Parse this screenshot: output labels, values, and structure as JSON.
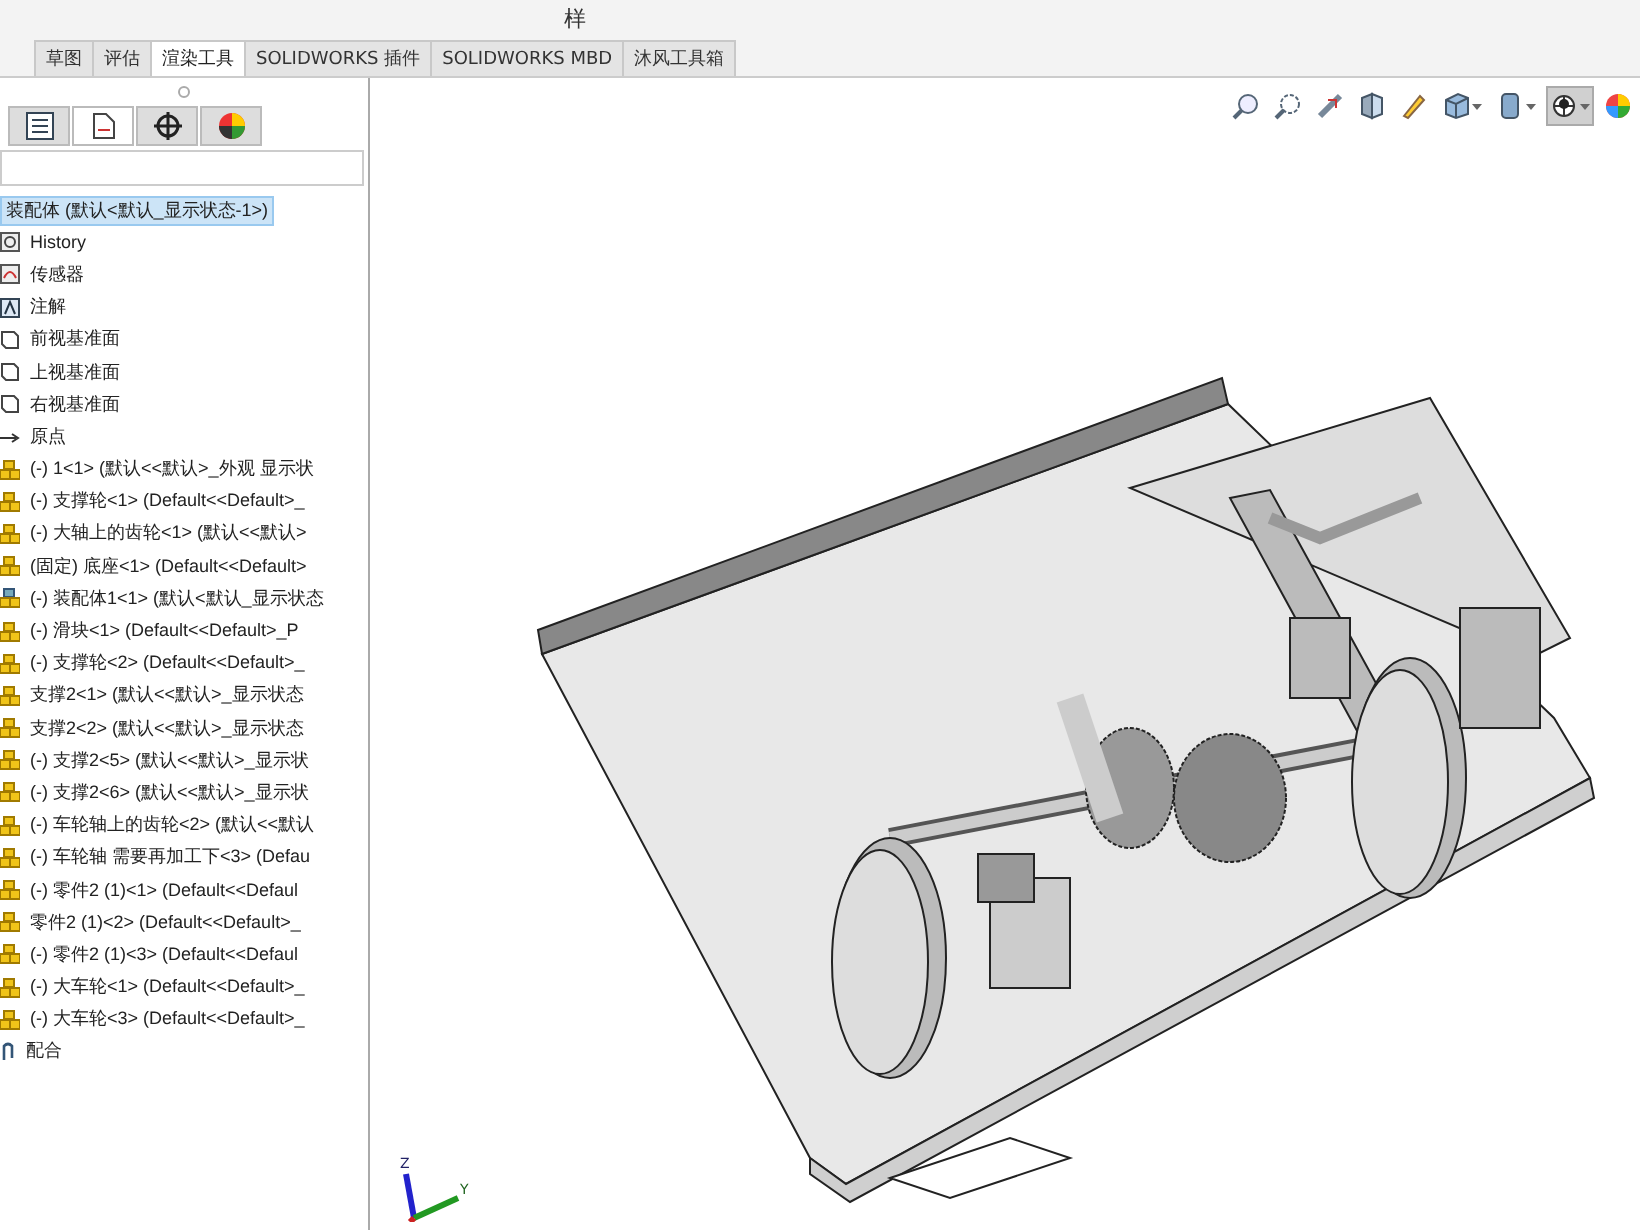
{
  "ribbon_labels": [
    "样"
  ],
  "tabs": [
    {
      "label": "草图",
      "selected": false
    },
    {
      "label": "评估",
      "selected": false
    },
    {
      "label": "渲染工具",
      "selected": true
    },
    {
      "label": "SOLIDWORKS 插件",
      "selected": false
    },
    {
      "label": "SOLIDWORKS MBD",
      "selected": false
    },
    {
      "label": "沐风工具箱",
      "selected": false
    }
  ],
  "panel_tabs": [
    {
      "kind": "tree",
      "selected": false
    },
    {
      "kind": "property",
      "selected": true
    },
    {
      "kind": "config",
      "selected": false
    },
    {
      "kind": "display",
      "selected": false
    }
  ],
  "view_tools": [
    {
      "kind": "zoom",
      "pressed": false
    },
    {
      "kind": "zoom-area",
      "pressed": false
    },
    {
      "kind": "previous",
      "pressed": false
    },
    {
      "kind": "section",
      "pressed": false
    },
    {
      "kind": "dynamic",
      "pressed": false
    },
    {
      "kind": "orientation",
      "pressed": false
    },
    {
      "kind": "display-style",
      "pressed": false
    },
    {
      "kind": "hide-show",
      "pressed": true
    },
    {
      "kind": "appearance",
      "pressed": false
    }
  ],
  "tree": {
    "root": {
      "label": "装配体  (默认<默认_显示状态-1>)",
      "selected": true
    },
    "items": [
      {
        "kind": "history",
        "label": "History"
      },
      {
        "kind": "sensor",
        "label": "传感器"
      },
      {
        "kind": "annotation",
        "label": "注解"
      },
      {
        "kind": "plane",
        "label": "前视基准面"
      },
      {
        "kind": "plane",
        "label": "上视基准面"
      },
      {
        "kind": "plane",
        "label": "右视基准面"
      },
      {
        "kind": "origin",
        "label": "原点"
      },
      {
        "kind": "part",
        "label": "(-) 1<1> (默认<<默认>_外观 显示状"
      },
      {
        "kind": "part",
        "label": "(-) 支撑轮<1> (Default<<Default>_"
      },
      {
        "kind": "part",
        "label": "(-) 大轴上的齿轮<1> (默认<<默认>"
      },
      {
        "kind": "part",
        "label": "(固定) 底座<1> (Default<<Default>"
      },
      {
        "kind": "assembly",
        "label": "(-) 装配体1<1> (默认<默认_显示状态"
      },
      {
        "kind": "part",
        "label": "(-) 滑块<1> (Default<<Default>_P"
      },
      {
        "kind": "part",
        "label": "(-) 支撑轮<2> (Default<<Default>_"
      },
      {
        "kind": "part",
        "label": "支撑2<1> (默认<<默认>_显示状态"
      },
      {
        "kind": "part",
        "label": "支撑2<2> (默认<<默认>_显示状态"
      },
      {
        "kind": "part",
        "label": "(-) 支撑2<5> (默认<<默认>_显示状"
      },
      {
        "kind": "part",
        "label": "(-) 支撑2<6> (默认<<默认>_显示状"
      },
      {
        "kind": "part",
        "label": "(-) 车轮轴上的齿轮<2> (默认<<默认"
      },
      {
        "kind": "part",
        "label": "(-) 车轮轴 需要再加工下<3> (Defau"
      },
      {
        "kind": "part",
        "label": "(-) 零件2 (1)<1> (Default<<Defaul"
      },
      {
        "kind": "part",
        "label": "零件2 (1)<2> (Default<<Default>_"
      },
      {
        "kind": "part",
        "label": "(-) 零件2 (1)<3> (Default<<Defaul"
      },
      {
        "kind": "part",
        "label": "(-) 大车轮<1> (Default<<Default>_"
      },
      {
        "kind": "part",
        "label": "(-) 大车轮<3> (Default<<Default>_"
      },
      {
        "kind": "mates",
        "label": "配合"
      }
    ]
  },
  "triad": {
    "z": "Z",
    "y": "Y"
  }
}
